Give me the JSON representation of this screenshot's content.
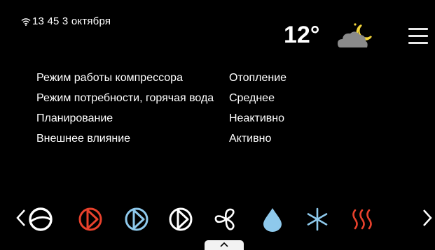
{
  "status_bar": {
    "wifi_icon": "wifi-icon",
    "time_date": "13 45 3 октября"
  },
  "weather": {
    "temperature": "12°",
    "icon": "partly-cloudy-night-icon"
  },
  "menu": {
    "icon": "hamburger-menu-icon"
  },
  "info_rows": [
    {
      "label": "Режим работы компрессора",
      "value": "Отопление"
    },
    {
      "label": "Режим потребности, горячая вода",
      "value": "Среднее"
    },
    {
      "label": "Планирование",
      "value": "Неактивно"
    },
    {
      "label": "Внешнее влияние",
      "value": "Активно"
    }
  ],
  "bottom_bar": {
    "icons": [
      {
        "name": "compressor-icon",
        "color": "#ffffff"
      },
      {
        "name": "heating-mode-icon",
        "color": "#e8412c"
      },
      {
        "name": "hot-water-mode-icon",
        "color": "#8ec9ec"
      },
      {
        "name": "operating-mode-icon",
        "color": "#ffffff"
      },
      {
        "name": "fan-icon",
        "color": "#ffffff"
      },
      {
        "name": "water-drop-icon",
        "color": "#8ec9ec"
      },
      {
        "name": "cooling-snowflake-icon",
        "color": "#8ec9ec"
      },
      {
        "name": "heat-waves-icon",
        "color": "#e8412c"
      }
    ],
    "left_arrow": "chevron-left-icon",
    "right_arrow": "chevron-right-icon",
    "drawer_handle": "chevron-up-icon"
  },
  "colors": {
    "background": "#000000",
    "text": "#ffffff",
    "accent_red": "#e8412c",
    "accent_blue": "#8ec9ec",
    "cloud_gray": "#8a8a8a",
    "moon_yellow": "#f2d43a"
  }
}
